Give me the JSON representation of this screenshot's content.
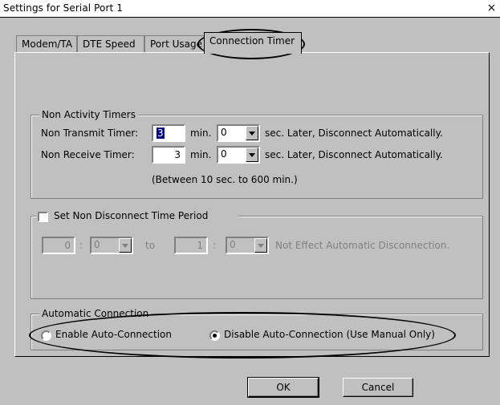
{
  "window": {
    "title": "Settings for Serial Port 1",
    "close_symbol": "×"
  },
  "tabs": [
    {
      "label": "Modem/TA"
    },
    {
      "label": "DTE Speed"
    },
    {
      "label": "Port Usage"
    },
    {
      "label": "Connection Timer",
      "active": true
    }
  ],
  "non_activity": {
    "title": "Non Activity Timers",
    "transmit": {
      "label": "Non Transmit Timer:",
      "min_value": "3",
      "min_unit": "min.",
      "sec_value": "0",
      "suffix": "sec. Later, Disconnect Automatically."
    },
    "receive": {
      "label": "Non Receive Timer:",
      "min_value": "3",
      "min_unit": "min.",
      "sec_value": "0",
      "suffix": "sec. Later, Disconnect Automatically."
    },
    "range_note": "(Between 10 sec. to 600 min.)"
  },
  "non_disconnect": {
    "checkbox_label": "Set Non Disconnect Time Period",
    "checked": false,
    "from_hour": "0",
    "colon1": ":",
    "from_min": "0",
    "to_label": "to",
    "to_hour": "1",
    "colon2": ":",
    "to_min": "0",
    "note": "Not Effect Automatic Disconnection."
  },
  "auto_connection": {
    "title": "Automatic Connection",
    "enable_label": "Enable Auto-Connection",
    "disable_label": "Disable Auto-Connection (Use Manual Only)",
    "selected": "disable"
  },
  "buttons": {
    "ok": "OK",
    "cancel": "Cancel"
  }
}
